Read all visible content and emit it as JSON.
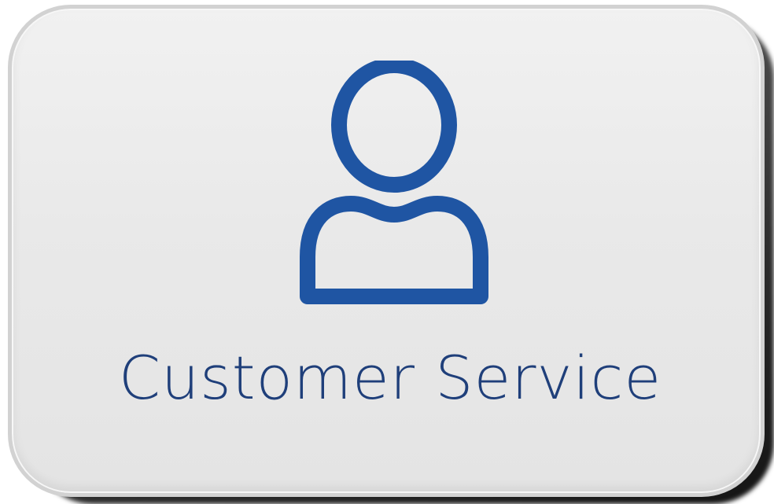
{
  "tile": {
    "label": "Customer Service",
    "icon": "user-icon"
  },
  "colors": {
    "icon_stroke": "#1f55a3",
    "label_text": "#1f3f7a",
    "card_background": "#e9e9e9"
  }
}
